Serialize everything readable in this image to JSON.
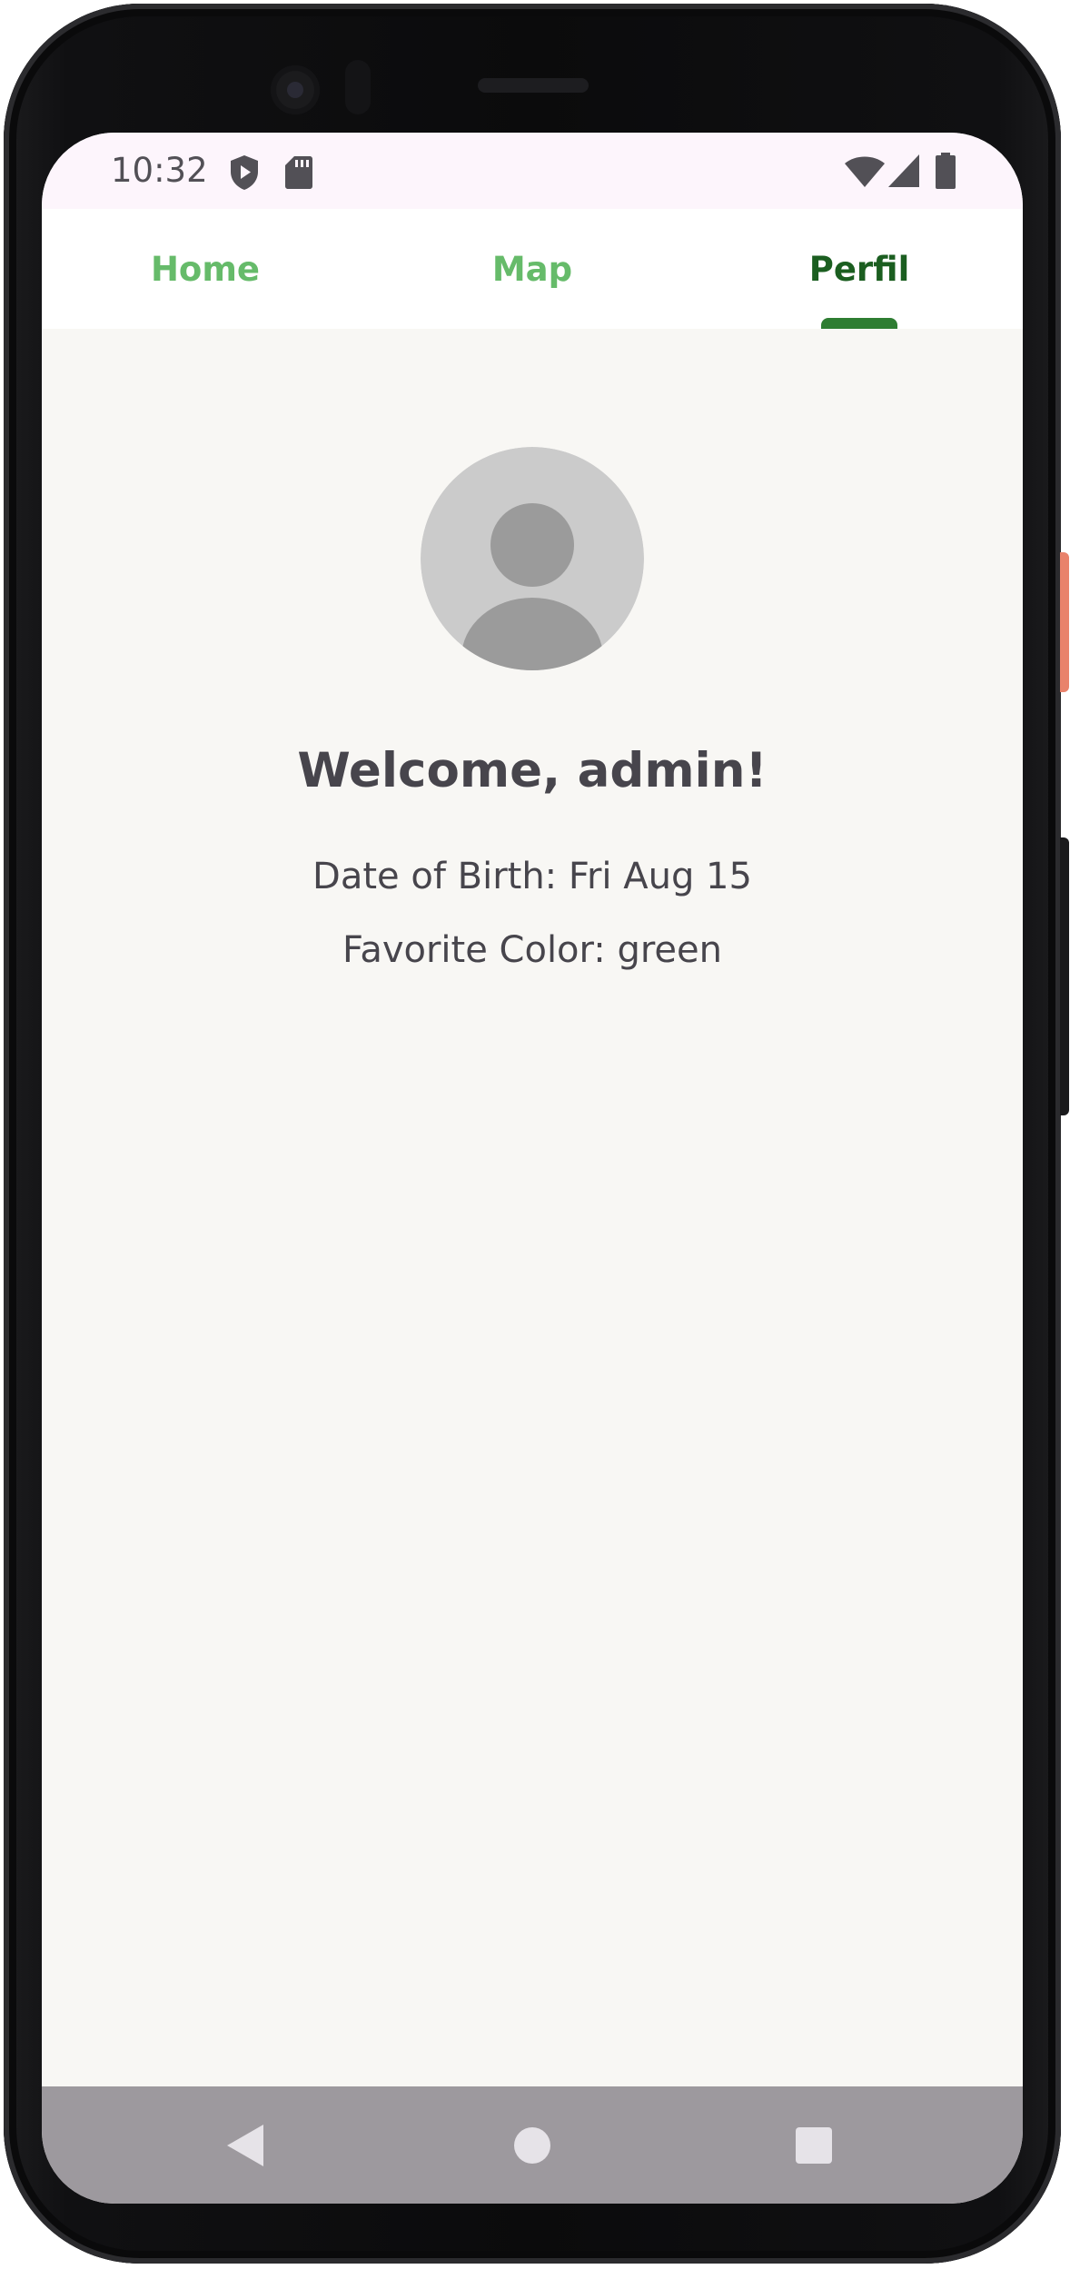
{
  "status_bar": {
    "time": "10:32",
    "left_icons": [
      "shield-play-icon",
      "sd-card-icon"
    ],
    "right_icons": [
      "wifi-icon",
      "cell-signal-icon",
      "battery-icon"
    ]
  },
  "tabs": [
    {
      "label": "Home",
      "active": false
    },
    {
      "label": "Map",
      "active": false
    },
    {
      "label": "Perfil",
      "active": true
    }
  ],
  "profile": {
    "avatar_icon": "default-avatar-icon",
    "welcome": "Welcome, admin!",
    "date_of_birth": "Date of Birth: Fri Aug 15",
    "favorite_color": "Favorite Color: green"
  },
  "nav_bar": {
    "buttons": [
      "back-icon",
      "home-icon",
      "recents-icon"
    ]
  },
  "colors": {
    "tab_inactive": "#66bb6a",
    "tab_active": "#1b5e20",
    "indicator": "#2e7d32",
    "content_bg": "#f8f7f4",
    "text": "#47454c",
    "status_bar_bg": "#fdf5fc",
    "nav_bar_bg": "#9d999e"
  }
}
